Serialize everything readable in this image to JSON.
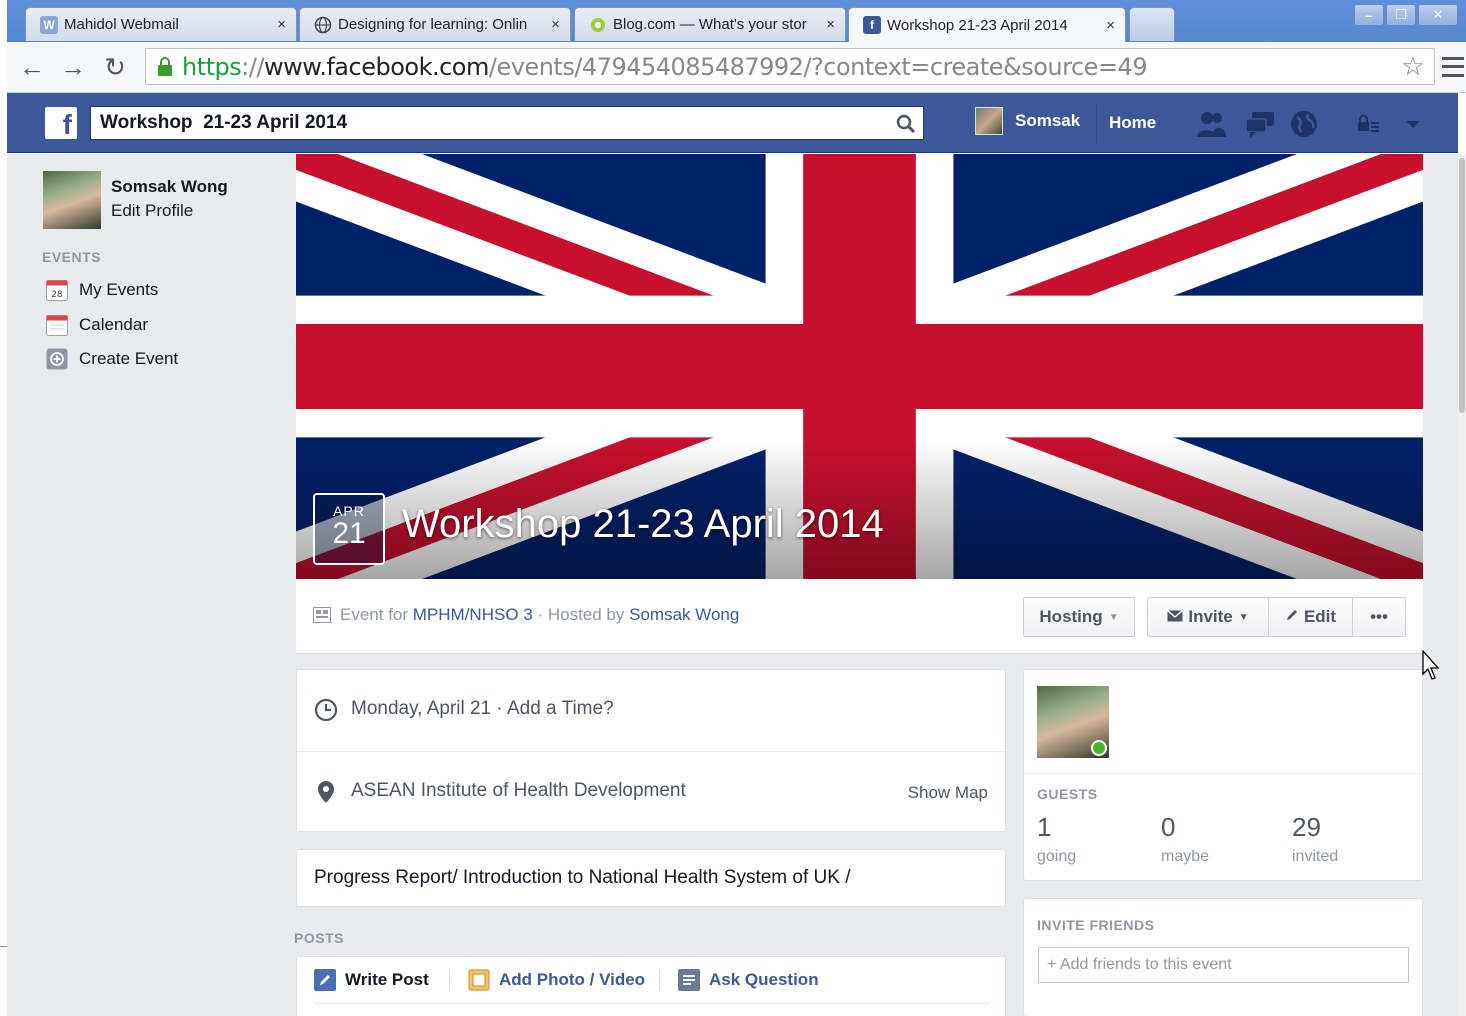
{
  "browser": {
    "tabs": [
      {
        "title": "Mahidol Webmail",
        "favicon": "mahidol-icon"
      },
      {
        "title": "Designing for learning: Onlin",
        "favicon": "globe-icon"
      },
      {
        "title": "Blog.com — What's your stor",
        "favicon": "blog-icon"
      },
      {
        "title": "Workshop 21-23 April 2014",
        "favicon": "facebook-icon",
        "active": true
      }
    ],
    "close_glyph": "×",
    "url": {
      "scheme": "https",
      "sep": "://",
      "host": "www.facebook.com",
      "path": "/events/479454085487992/?context=create&source=49"
    }
  },
  "fbbar": {
    "search_value": "Workshop  21-23 April 2014",
    "user_name": "Somsak",
    "home_label": "Home"
  },
  "leftnav": {
    "name": "Somsak Wong",
    "edit_profile": "Edit Profile",
    "heading": "EVENTS",
    "items": [
      {
        "label": "My Events",
        "icon": "calendar-28-icon",
        "badge": "28"
      },
      {
        "label": "Calendar",
        "icon": "calendar-icon"
      },
      {
        "label": "Create Event",
        "icon": "plus-circle-icon"
      }
    ]
  },
  "event": {
    "month": "APR",
    "day": "21",
    "title": "Workshop 21-23 April 2014",
    "meta_prefix": "Event for ",
    "group": "MPHM/NHSO 3",
    "meta_mid": " · Hosted by ",
    "host": "Somsak Wong",
    "buttons": {
      "hosting": "Hosting",
      "invite": "Invite",
      "edit": "Edit",
      "more": "•••"
    },
    "date_text": "Monday, April 21",
    "add_time": " · Add a Time?",
    "location": "ASEAN Institute of Health Development",
    "show_map": "Show Map",
    "description": "Progress Report/ Introduction to National Health System of UK /"
  },
  "guests": {
    "heading": "GUESTS",
    "stats": [
      {
        "value": "1",
        "label": "going"
      },
      {
        "value": "0",
        "label": "maybe"
      },
      {
        "value": "29",
        "label": "invited"
      }
    ]
  },
  "invite_friends": {
    "heading": "INVITE FRIENDS",
    "placeholder": "+ Add friends to this event"
  },
  "posts": {
    "heading": "POSTS",
    "tabs": [
      "Write Post",
      "Add Photo / Video",
      "Ask Question"
    ]
  },
  "colors": {
    "facebook_blue": "#3b5998",
    "flag_blue": "#012169",
    "flag_red": "#c8102e",
    "link": "#3b5998"
  }
}
